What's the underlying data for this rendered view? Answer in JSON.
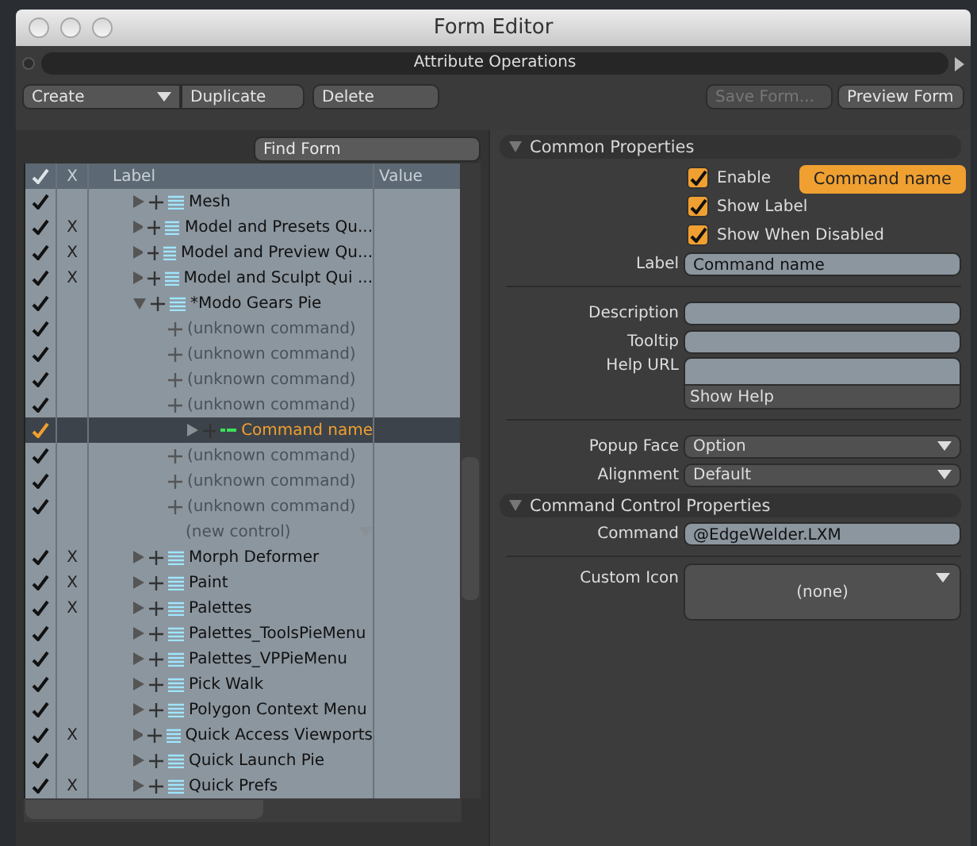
{
  "window": {
    "title": "Form Editor"
  },
  "attribute_bar": {
    "title": "Attribute Operations"
  },
  "toolbar": {
    "buttons": [
      {
        "label": "Create",
        "kind": "dropdown",
        "disabled": false
      },
      {
        "label": "Duplicate",
        "kind": "button",
        "disabled": false
      },
      {
        "label": "Delete",
        "kind": "button",
        "disabled": false
      }
    ],
    "right_buttons": [
      {
        "label": "Save Form...",
        "disabled": true
      },
      {
        "label": "Preview Form",
        "disabled": false
      }
    ]
  },
  "find_button": "Find Form",
  "tree": {
    "columns": [
      "X",
      "Label",
      "Value"
    ],
    "rows": [
      {
        "label": "Mesh",
        "enabled": true,
        "kind": "form",
        "expanded": false,
        "selected": false
      },
      {
        "label": "Model and Presets Qu...",
        "enabled": true,
        "x": "X",
        "kind": "form",
        "expanded": false,
        "selected": false
      },
      {
        "label": "Model and Preview Qu...",
        "enabled": true,
        "x": "X",
        "kind": "form",
        "expanded": false,
        "selected": false
      },
      {
        "label": "Model and Sculpt Qui ...",
        "enabled": true,
        "x": "X",
        "kind": "form",
        "expanded": false,
        "selected": false
      },
      {
        "label": "*Modo Gears Pie",
        "enabled": true,
        "kind": "form",
        "expanded": true,
        "selected": false,
        "children": [
          {
            "label": "(unknown command)",
            "enabled": true,
            "kind": "unknown",
            "selected": false
          },
          {
            "label": "(unknown command)",
            "enabled": true,
            "kind": "unknown",
            "selected": false
          },
          {
            "label": "(unknown command)",
            "enabled": true,
            "kind": "unknown",
            "selected": false
          },
          {
            "label": "(unknown command)",
            "enabled": true,
            "kind": "unknown",
            "selected": false
          },
          {
            "label": "Command name",
            "enabled": true,
            "kind": "command",
            "expanded": false,
            "selected": true
          },
          {
            "label": "(unknown command)",
            "enabled": true,
            "kind": "unknown",
            "selected": false
          },
          {
            "label": "(unknown command)",
            "enabled": true,
            "kind": "unknown",
            "selected": false
          },
          {
            "label": "(unknown command)",
            "enabled": true,
            "kind": "unknown",
            "selected": false
          },
          {
            "label": "(new control)",
            "enabled": false,
            "kind": "new",
            "selected": false
          }
        ]
      },
      {
        "label": "Morph Deformer",
        "enabled": true,
        "x": "X",
        "kind": "form",
        "expanded": false,
        "selected": false
      },
      {
        "label": "Paint",
        "enabled": true,
        "x": "X",
        "kind": "form",
        "expanded": false,
        "selected": false
      },
      {
        "label": "Palettes",
        "enabled": true,
        "x": "X",
        "kind": "form",
        "expanded": false,
        "selected": false
      },
      {
        "label": "Palettes_ToolsPieMenu",
        "enabled": true,
        "kind": "form",
        "expanded": false,
        "selected": false
      },
      {
        "label": "Palettes_VPPieMenu",
        "enabled": true,
        "kind": "form",
        "expanded": false,
        "selected": false
      },
      {
        "label": "Pick Walk",
        "enabled": true,
        "kind": "form",
        "expanded": false,
        "selected": false
      },
      {
        "label": "Polygon Context Menu",
        "enabled": true,
        "kind": "form",
        "expanded": false,
        "selected": false
      },
      {
        "label": "Quick Access Viewports",
        "enabled": true,
        "x": "X",
        "kind": "form",
        "expanded": false,
        "selected": false
      },
      {
        "label": "Quick Launch Pie",
        "enabled": true,
        "kind": "form",
        "expanded": false,
        "selected": false
      },
      {
        "label": "Quick Prefs",
        "enabled": true,
        "x": "X",
        "kind": "form",
        "expanded": false,
        "selected": false
      }
    ]
  },
  "common_properties": {
    "title": "Common Properties",
    "expanded": true,
    "checkboxes": [
      {
        "label": "Enable",
        "checked": true
      },
      {
        "label": "Show Label",
        "checked": true
      },
      {
        "label": "Show When Disabled",
        "checked": true
      }
    ],
    "badge": "Command name",
    "label_field": {
      "label": "Label",
      "value": "Command name"
    },
    "description": {
      "label": "Description"
    },
    "tooltip": {
      "label": "Tooltip"
    },
    "help_url": {
      "label": "Help URL",
      "button": "Show Help"
    },
    "popup_face": {
      "label": "Popup Face",
      "value": "Option"
    },
    "alignment": {
      "label": "Alignment",
      "value": "Default"
    }
  },
  "command_properties": {
    "title": "Command Control Properties",
    "expanded": true,
    "command": {
      "label": "Command",
      "value": "@EdgeWelder.LXM"
    },
    "custom_icon": {
      "label": "Custom Icon",
      "value": "(none)"
    }
  }
}
